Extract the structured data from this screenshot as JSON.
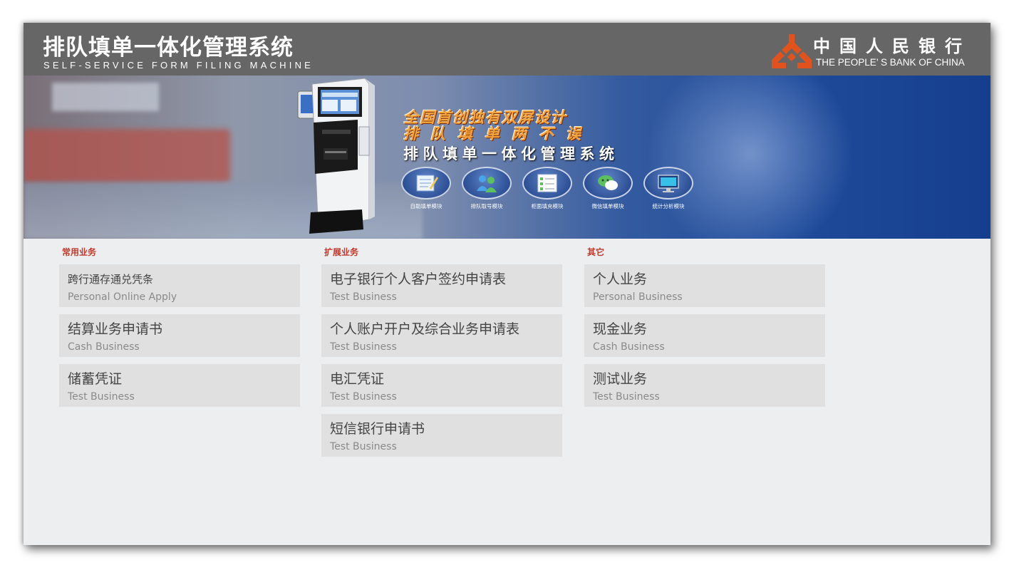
{
  "header": {
    "title": "排队填单一体化管理系统",
    "subtitle": "SELF-SERVICE FORM FILING MACHINE",
    "bank_name_cn": "中国人民银行",
    "bank_name_en": "THE PEOPLE’ S BANK OF CHINA",
    "logo_icon": "pboc-logo-icon",
    "background_color": "#666666",
    "logo_color": "#e2521c"
  },
  "banner": {
    "slogan_line1": "全国首创独有双屏设计",
    "slogan_line2": "排队填单两不误",
    "slogan_line3": "排队填单一体化管理系统",
    "modules": [
      {
        "label": "自助填单模块",
        "icon": "form-notepad-icon"
      },
      {
        "label": "排队取号模块",
        "icon": "people-queue-icon"
      },
      {
        "label": "柜面填充模块",
        "icon": "checklist-icon"
      },
      {
        "label": "微信填单模块",
        "icon": "wechat-icon"
      },
      {
        "label": "统计分析模块",
        "icon": "monitor-chart-icon"
      }
    ]
  },
  "columns": [
    {
      "heading": "常用业务",
      "items": [
        {
          "name": "跨行通存通兑凭条",
          "sub": "Personal Online Apply"
        },
        {
          "name": "结算业务申请书",
          "sub": "Cash Business"
        },
        {
          "name": "储蓄凭证",
          "sub": "Test Business"
        }
      ]
    },
    {
      "heading": "扩展业务",
      "items": [
        {
          "name": "电子银行个人客户签约申请表",
          "sub": "Test Business"
        },
        {
          "name": "个人账户开户及综合业务申请表",
          "sub": "Test Business"
        },
        {
          "name": "电汇凭证",
          "sub": "Test Business"
        },
        {
          "name": "短信银行申请书",
          "sub": "Test Business"
        }
      ]
    },
    {
      "heading": "其它",
      "items": [
        {
          "name": "个人业务",
          "sub": "Personal Business"
        },
        {
          "name": "现金业务",
          "sub": "Cash Business"
        },
        {
          "name": "测试业务",
          "sub": "Test Business"
        }
      ]
    }
  ],
  "colors": {
    "heading_red": "#c0392b",
    "card_bg": "#e0e0e0",
    "page_bg": "#eceef0"
  }
}
